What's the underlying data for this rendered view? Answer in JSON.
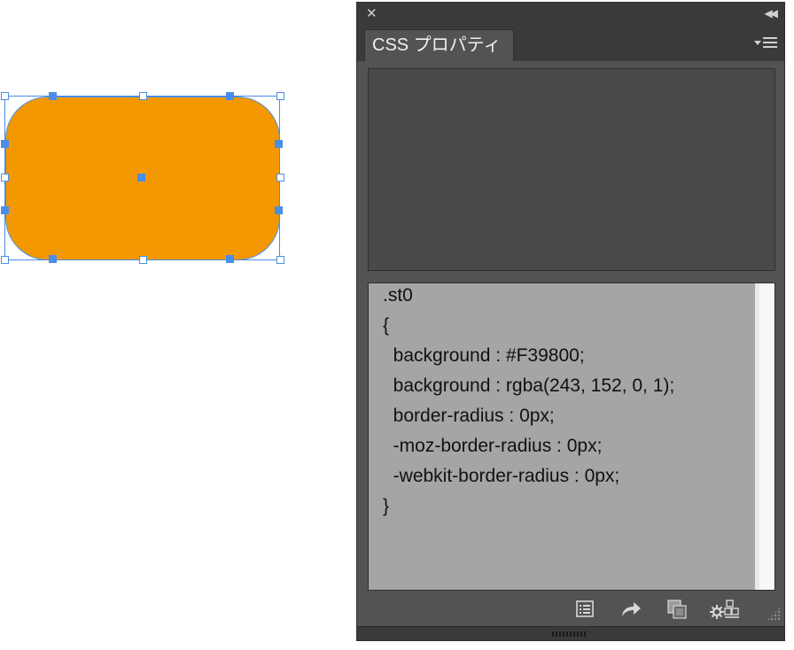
{
  "canvas": {
    "shape_fill": "#F39800",
    "selection_color": "#4A8EE6"
  },
  "panel": {
    "close_icon": "close-icon",
    "collapse_icon": "double-chevron-left-icon",
    "tab_label": "CSS プロパティ",
    "menu_icon": "panel-menu-icon",
    "code_lines": [
      ".st0",
      "{",
      "  background : #F39800;",
      "  background : rgba(243, 152, 0, 1);",
      "  border-radius : 0px;",
      "  -moz-border-radius : 0px;",
      "  -webkit-border-radius : 0px;",
      "}"
    ],
    "toolbar_icons": [
      "list-icon",
      "export-arrow-icon",
      "copy-layers-icon",
      "settings-options-icon"
    ]
  }
}
